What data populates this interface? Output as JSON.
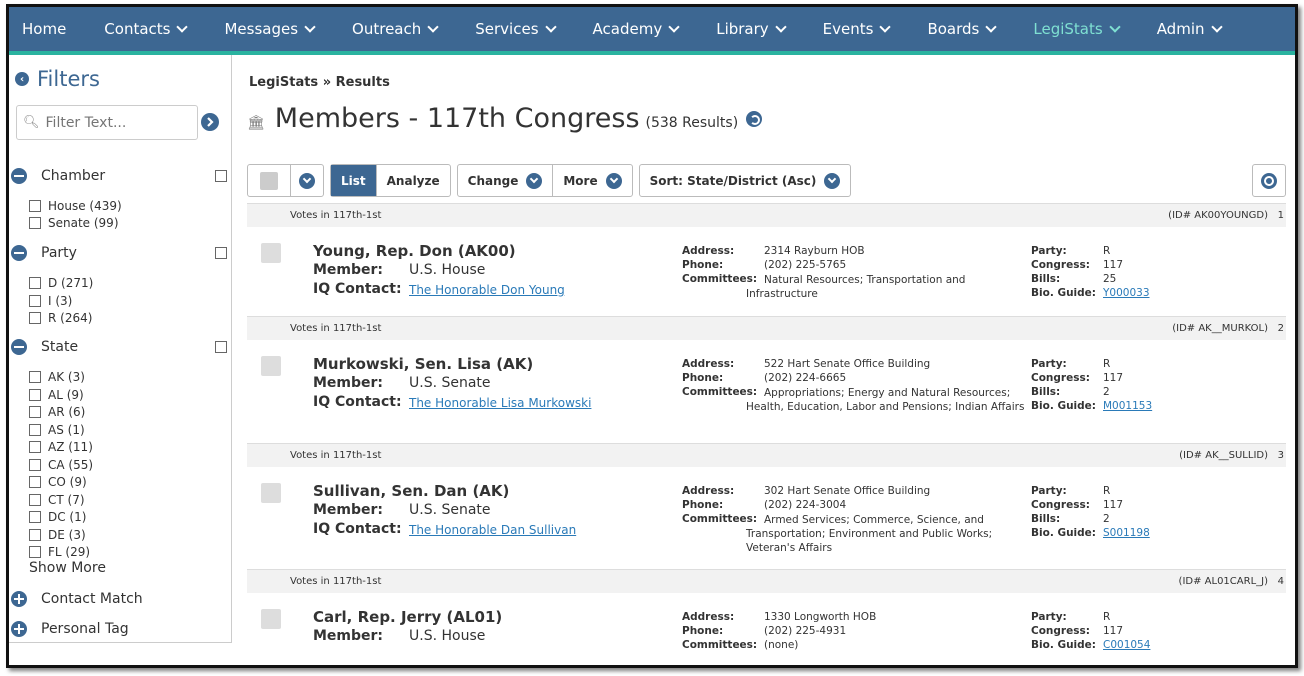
{
  "nav": {
    "items": [
      {
        "label": "Home",
        "dropdown": false
      },
      {
        "label": "Contacts",
        "dropdown": true
      },
      {
        "label": "Messages",
        "dropdown": true
      },
      {
        "label": "Outreach",
        "dropdown": true
      },
      {
        "label": "Services",
        "dropdown": true
      },
      {
        "label": "Academy",
        "dropdown": true
      },
      {
        "label": "Library",
        "dropdown": true
      },
      {
        "label": "Events",
        "dropdown": true
      },
      {
        "label": "Boards",
        "dropdown": true
      },
      {
        "label": "LegiStats",
        "dropdown": true,
        "active": true
      },
      {
        "label": "Admin",
        "dropdown": true
      }
    ]
  },
  "sidebar": {
    "title": "Filters",
    "filter_placeholder": "Filter Text...",
    "sections": {
      "chamber": {
        "label": "Chamber",
        "options": [
          "House (439)",
          "Senate (99)"
        ]
      },
      "party": {
        "label": "Party",
        "options": [
          "D (271)",
          "I (3)",
          "R (264)"
        ]
      },
      "state": {
        "label": "State",
        "options": [
          "AK (3)",
          "AL (9)",
          "AR (6)",
          "AS (1)",
          "AZ (11)",
          "CA (55)",
          "CO (9)",
          "CT (7)",
          "DC (1)",
          "DE (3)",
          "FL (29)"
        ]
      },
      "show_more": "Show More",
      "contact_match": "Contact Match",
      "personal_tag": "Personal Tag"
    }
  },
  "breadcrumb": "LegiStats » Results",
  "page": {
    "title": "Members - 117th Congress",
    "count": "(538 Results)"
  },
  "toolbar": {
    "list": "List",
    "analyze": "Analyze",
    "change": "Change",
    "more": "More",
    "sort": "Sort: State/District (Asc)"
  },
  "labels": {
    "member": "Member:",
    "iq_contact": "IQ Contact:",
    "address": "Address:",
    "phone": "Phone:",
    "committees": "Committees:",
    "party": "Party:",
    "congress": "Congress:",
    "bills": "Bills:",
    "bio_guide": "Bio. Guide:"
  },
  "records": [
    {
      "votes": "Votes in 117th-1st",
      "id": "(ID# AK00YOUNGD)",
      "num": "1",
      "name": "Young, Rep. Don (AK00)",
      "member": "U.S. House",
      "iq_contact": "The Honorable Don Young",
      "address": "2314 Rayburn HOB",
      "phone": "(202) 225-5765",
      "committees": "Natural Resources; Transportation and Infrastructure",
      "party": "R",
      "congress": "117",
      "bills": "25",
      "bio_guide": "Y000033"
    },
    {
      "votes": "Votes in 117th-1st",
      "id": "(ID# AK__MURKOL)",
      "num": "2",
      "name": "Murkowski, Sen. Lisa (AK)",
      "member": "U.S. Senate",
      "iq_contact": "The Honorable Lisa Murkowski",
      "address": "522 Hart Senate Office Building",
      "phone": "(202) 224-6665",
      "committees": "Appropriations; Energy and Natural Resources; Health, Education, Labor and Pensions; Indian Affairs",
      "party": "R",
      "congress": "117",
      "bills": "2",
      "bio_guide": "M001153"
    },
    {
      "votes": "Votes in 117th-1st",
      "id": "(ID# AK__SULLID)",
      "num": "3",
      "name": "Sullivan, Sen. Dan (AK)",
      "member": "U.S. Senate",
      "iq_contact": "The Honorable Dan Sullivan",
      "address": "302 Hart Senate Office Building",
      "phone": "(202) 224-3004",
      "committees": "Armed Services; Commerce, Science, and Transportation; Environment and Public Works; Veteran's Affairs",
      "party": "R",
      "congress": "117",
      "bills": "2",
      "bio_guide": "S001198"
    },
    {
      "votes": "Votes in 117th-1st",
      "id": "(ID# AL01CARL_J)",
      "num": "4",
      "name": "Carl, Rep. Jerry (AL01)",
      "member": "U.S. House",
      "address": "1330 Longworth HOB",
      "phone": "(202) 225-4931",
      "committees": "(none)",
      "party": "R",
      "congress": "117",
      "bio_guide": "C001054"
    }
  ]
}
